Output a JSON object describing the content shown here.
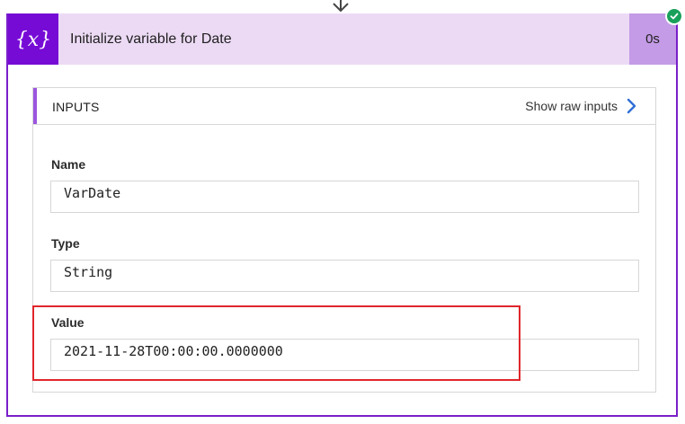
{
  "action": {
    "icon": "variable-icon",
    "title": "Initialize variable for Date",
    "duration": "0s",
    "status_icon": "success-check-icon"
  },
  "inputs": {
    "header": "INPUTS",
    "show_raw_label": "Show raw inputs",
    "fields": [
      {
        "label": "Name",
        "value": "VarDate"
      },
      {
        "label": "Type",
        "value": "String"
      },
      {
        "label": "Value",
        "value": "2021-11-28T00:00:00.0000000"
      }
    ]
  },
  "colors": {
    "accent_purple": "#770bd6",
    "header_bg": "#ecdaf5",
    "duration_bg": "#c49be6",
    "success_green": "#19a05a",
    "highlight_red": "#e0262c",
    "link_blue": "#2f6ed6"
  }
}
